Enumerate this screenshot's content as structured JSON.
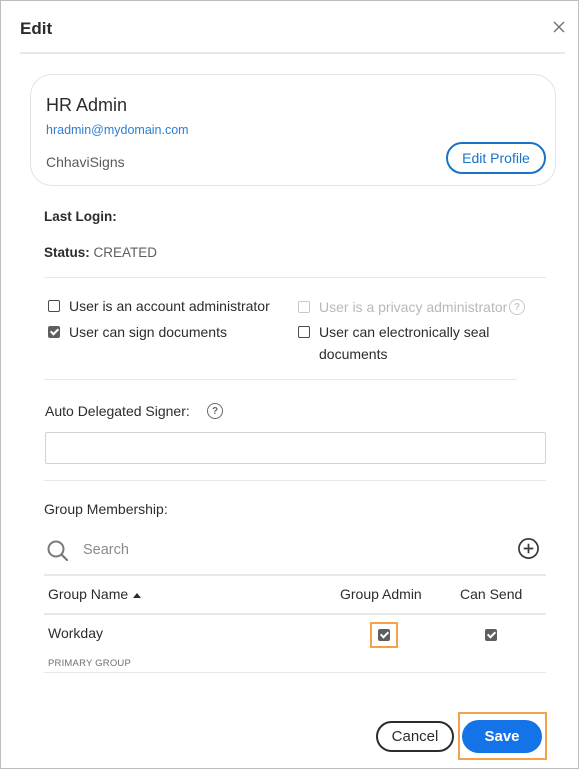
{
  "dialog": {
    "title": "Edit",
    "close_icon": "close-icon"
  },
  "profile": {
    "name": "HR Admin",
    "email": "hradmin@mydomain.com",
    "organization": "ChhaviSigns",
    "edit_button": "Edit Profile"
  },
  "info": {
    "last_login_label": "Last Login:",
    "last_login_value": "",
    "status_label": "Status:",
    "status_value": "CREATED"
  },
  "permissions": [
    {
      "label": "User is an account administrator",
      "checked": false,
      "disabled": false
    },
    {
      "label": "User can sign documents",
      "checked": true,
      "disabled": false
    },
    {
      "label": "User is a privacy administrator",
      "checked": false,
      "disabled": true,
      "help_icon": "help-icon"
    },
    {
      "label": "User can electronically seal documents",
      "checked": false,
      "disabled": false
    }
  ],
  "delegated_signer": {
    "label": "Auto Delegated Signer:",
    "value": "",
    "placeholder": "",
    "help_icon": "help-icon"
  },
  "groups": {
    "label": "Group Membership:",
    "search_placeholder": "Search",
    "add_icon": "add-circle-icon",
    "columns": [
      "Group Name",
      "Group Admin",
      "Can Send"
    ],
    "sort": "ascending",
    "rows": [
      {
        "name": "Workday",
        "subtitle": "PRIMARY GROUP",
        "group_admin": true,
        "can_send": true
      }
    ]
  },
  "footer": {
    "cancel": "Cancel",
    "save": "Save"
  },
  "colors": {
    "accent": "#1473e6",
    "link": "#2d7dd2",
    "focus": "#f5a14a"
  }
}
